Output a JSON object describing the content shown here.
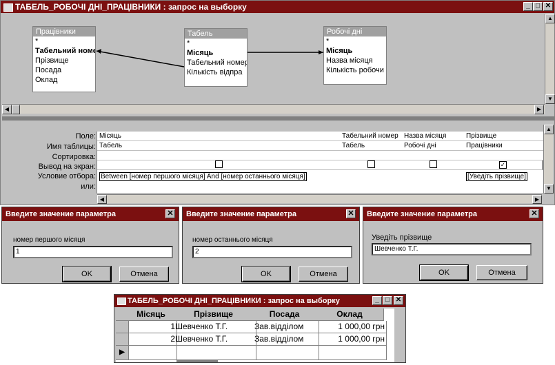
{
  "query_window": {
    "title": "ТАБЕЛЬ_РОБОЧІ ДНІ_ПРАЦІВНИКИ : запрос на выборку",
    "tables": [
      {
        "name": "Працівники",
        "fields": [
          "*",
          "Табельний номер",
          "Прізвище",
          "Посада",
          "Оклад"
        ],
        "bold_index": 1
      },
      {
        "name": "Табель",
        "fields": [
          "*",
          "Місяць",
          "Табельний номер",
          "Кількість відпра"
        ],
        "bold_index": 1
      },
      {
        "name": "Робочі дні",
        "fields": [
          "*",
          "Місяць",
          "Назва місяця",
          "Кількість робочи"
        ],
        "bold_index": 1
      }
    ],
    "grid_labels": [
      "Поле:",
      "Имя таблицы:",
      "Сортировка:",
      "Вывод на экран:",
      "Условие отбора:",
      "или:"
    ],
    "columns": [
      {
        "field": "Місяць",
        "table": "Табель",
        "sort": "",
        "show": false,
        "condition": "Between [номер першого місяця] And [номер останнього місяця]"
      },
      {
        "field": "Табельний номер",
        "table": "Табель",
        "sort": "",
        "show": false,
        "condition": ""
      },
      {
        "field": "Назва місяця",
        "table": "Робочі дні",
        "sort": "",
        "show": false,
        "condition": ""
      },
      {
        "field": "Прізвище",
        "table": "Працівники",
        "sort": "",
        "show": true,
        "condition": "[Уведіть прізвище]"
      }
    ],
    "checkmark": "✓"
  },
  "dialogs": [
    {
      "title": "Введите значение параметра",
      "prompt": "номер першого місяця",
      "value": "1",
      "ok": "OK",
      "cancel": "Отмена"
    },
    {
      "title": "Введите значение параметра",
      "prompt": "номер останнього місяця",
      "value": "2",
      "ok": "OK",
      "cancel": "Отмена"
    },
    {
      "title": "Введите значение параметра",
      "prompt": "Уведіть прізвище",
      "value": "Шевченко Т.Г.",
      "ok": "OK",
      "cancel": "Отмена"
    }
  ],
  "result_window": {
    "title": "ТАБЕЛЬ_РОБОЧІ ДНІ_ПРАЦІВНИКИ : запрос на выборку",
    "headers": [
      "Місяць",
      "Прізвище",
      "Посада",
      "Оклад"
    ],
    "rows": [
      [
        "1",
        "Шевченко Т.Г.",
        "Зав.відділом",
        "1 000,00 грн"
      ],
      [
        "2",
        "Шевченко Т.Г.",
        "Зав.відділом",
        "1 000,00 грн"
      ]
    ],
    "new_row_marker": "▶"
  },
  "window_buttons": {
    "minimize": "_",
    "maximize": "□",
    "close": "✕"
  },
  "colors": {
    "titlebar": "#7b1010",
    "panel": "#c0c0c0"
  }
}
